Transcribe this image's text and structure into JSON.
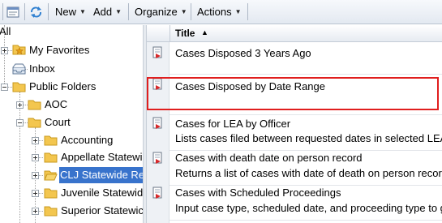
{
  "toolbar": {
    "new_label": "New",
    "add_label": "Add",
    "organize_label": "Organize",
    "actions_label": "Actions"
  },
  "tree": {
    "root_label": "All",
    "favorites_label": "My Favorites",
    "inbox_label": "Inbox",
    "public_label": "Public Folders",
    "aoc_label": "AOC",
    "court_label": "Court",
    "accounting_label": "Accounting",
    "appellate_label": "Appellate Statewi",
    "clj_label": "CLJ Statewide Re",
    "juvenile_label": "Juvenile Statewid",
    "superior_label": "Superior Statewic"
  },
  "list": {
    "column_title": "Title",
    "sort_indicator": "▲",
    "rows": [
      {
        "title": "Cases Disposed 3 Years Ago",
        "icon": "report-icon"
      },
      {
        "title": "Cases Disposed by Date Range",
        "icon": "report-icon"
      },
      {
        "title": "Cases for LEA by Officer",
        "icon": "report-icon"
      },
      {
        "title": "Lists cases filed between requested dates in selected LEA"
      },
      {
        "title": "Cases with death date on person record",
        "icon": "report-icon"
      },
      {
        "title": "Returns a list of cases with date of death on person record"
      },
      {
        "title": "Cases with Scheduled Proceedings",
        "icon": "report-icon"
      },
      {
        "title": "Input case type, scheduled date, and proceeding type to g"
      }
    ]
  },
  "colors": {
    "selection": "#3873cc",
    "highlight_border": "#e01e1e",
    "folder": "#f3c64f"
  }
}
